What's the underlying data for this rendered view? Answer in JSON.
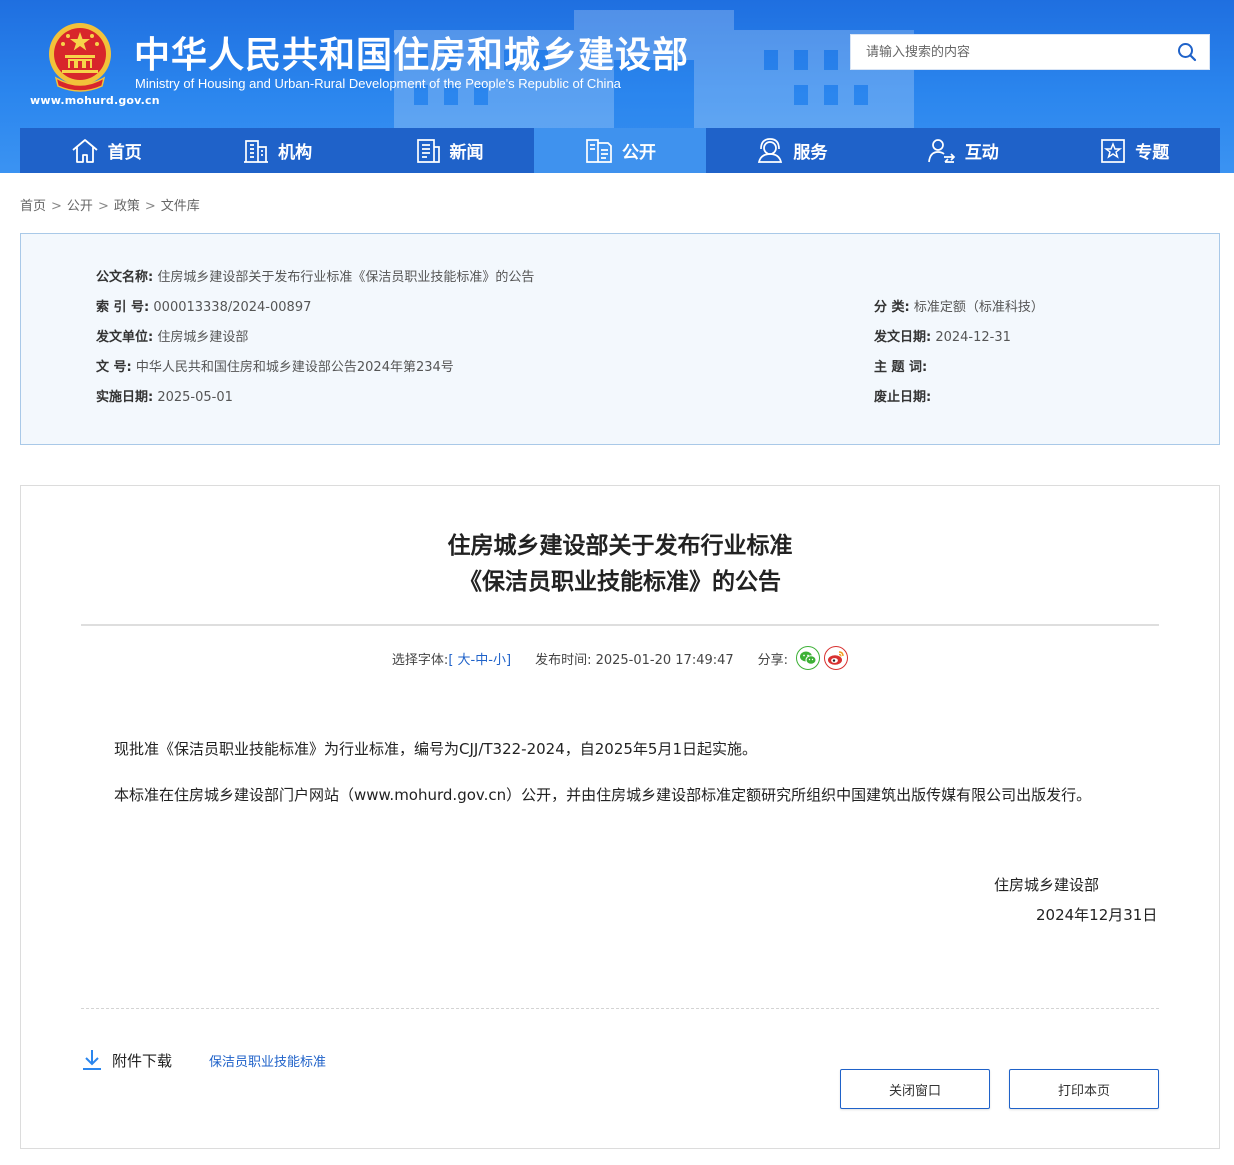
{
  "header": {
    "site_title": "中华人民共和国住房和城乡建设部",
    "site_subtitle": "Ministry of Housing and Urban-Rural Development of the People's Republic of China",
    "site_url": "www.mohurd.gov.cn",
    "search_placeholder": "请输入搜索的内容"
  },
  "nav": [
    {
      "label": "首页",
      "icon": "home-icon"
    },
    {
      "label": "机构",
      "icon": "building-icon"
    },
    {
      "label": "新闻",
      "icon": "news-icon"
    },
    {
      "label": "公开",
      "icon": "document-icon",
      "active": true
    },
    {
      "label": "服务",
      "icon": "service-icon"
    },
    {
      "label": "互动",
      "icon": "interaction-icon"
    },
    {
      "label": "专题",
      "icon": "star-icon"
    }
  ],
  "breadcrumb": [
    "首页",
    "公开",
    "政策",
    "文件库"
  ],
  "info": {
    "doc_name": {
      "label": "公文名称:",
      "value": "住房城乡建设部关于发布行业标准《保洁员职业技能标准》的公告"
    },
    "index_no": {
      "label": "索 引 号:",
      "value": "000013338/2024-00897"
    },
    "category": {
      "label": "分 类:",
      "value": "标准定额（标准科技）"
    },
    "issuer": {
      "label": "发文单位:",
      "value": "住房城乡建设部"
    },
    "issue_date": {
      "label": "发文日期:",
      "value": "2024-12-31"
    },
    "doc_no": {
      "label": "文 号:",
      "value": "中华人民共和国住房和城乡建设部公告2024年第234号"
    },
    "keywords": {
      "label": "主 题 词:",
      "value": ""
    },
    "effective_date": {
      "label": "实施日期:",
      "value": "2025-05-01"
    },
    "expiry_date": {
      "label": "废止日期:",
      "value": ""
    }
  },
  "article": {
    "title_line1": "住房城乡建设部关于发布行业标准",
    "title_line2": "《保洁员职业技能标准》的公告",
    "font_label": "选择字体:",
    "font_large": "大",
    "font_medium": "中",
    "font_small": "小",
    "publish_time_label": "发布时间:",
    "publish_time": "2025-01-20 17:49:47",
    "share_label": "分享:",
    "paragraph1": "现批准《保洁员职业技能标准》为行业标准，编号为CJJ/T322-2024，自2025年5月1日起实施。",
    "paragraph2": "本标准在住房城乡建设部门户网站（www.mohurd.gov.cn）公开，并由住房城乡建设部标准定额研究所组织中国建筑出版传媒有限公司出版发行。",
    "signature": "住房城乡建设部",
    "sign_date": "2024年12月31日",
    "attachment_label": "附件下载",
    "attachment_link": "保洁员职业技能标准",
    "close_button": "关闭窗口",
    "print_button": "打印本页"
  },
  "colors": {
    "header_blue": "#2b86ee",
    "nav_blue": "#1f62c9",
    "nav_active": "#3f92ee",
    "link_blue": "#1f62c9",
    "wechat_green": "#3cb035",
    "weibo_red": "#d8302f"
  }
}
